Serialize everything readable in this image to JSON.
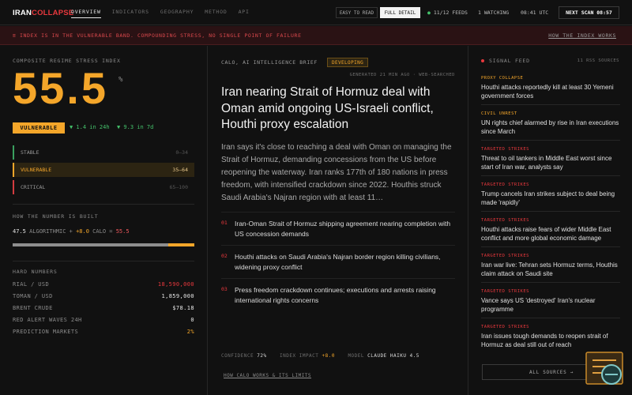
{
  "brand": {
    "part1": "IRAN",
    "part2": "COLLAPSE"
  },
  "nav": [
    {
      "label": "OVERVIEW",
      "active": true
    },
    {
      "label": "INDICATORS",
      "active": false
    },
    {
      "label": "GEOGRAPHY",
      "active": false
    },
    {
      "label": "METHOD",
      "active": false
    },
    {
      "label": "API",
      "active": false
    }
  ],
  "view_toggle": {
    "easy": "EASY TO READ",
    "full": "FULL DETAIL",
    "selected": "full"
  },
  "status": {
    "feeds": "11/12 FEEDS",
    "watching": "1 WATCHING",
    "time": "08:41 UTC",
    "next_scan": "NEXT SCAN 08:57"
  },
  "alert": {
    "message": "≡ INDEX IS IN THE VULNERABLE BAND. COMPOUNDING STRESS, NO SINGLE POINT OF FAILURE",
    "link": "HOW THE INDEX WORKS"
  },
  "index": {
    "label": "COMPOSITE REGIME STRESS INDEX",
    "value": "55.5",
    "unit": "%",
    "band": "VULNERABLE",
    "delta_24h": "▼ 1.4 in 24h",
    "delta_7d": "▼ 9.3 in 7d",
    "bands": [
      {
        "name": "STABLE",
        "range": "0–34"
      },
      {
        "name": "VULNERABLE",
        "range": "35–64"
      },
      {
        "name": "CRITICAL",
        "range": "65–100"
      }
    ]
  },
  "calc": {
    "label": "HOW THE NUMBER IS BUILT",
    "algorithmic": "47.5",
    "algorithmic_label": "ALGORITHMIC",
    "plus": "+",
    "calo": "+8.0",
    "calo_label": "CALO",
    "eq": "=",
    "total": "55.5",
    "algorithmic_share": 0.856,
    "calo_share": 0.144
  },
  "hard_numbers": {
    "label": "HARD NUMBERS",
    "rows": [
      {
        "name": "RIAL / USD",
        "value": "18,590,000",
        "tone": "red"
      },
      {
        "name": "TOMAN / USD",
        "value": "1,859,000",
        "tone": "white"
      },
      {
        "name": "BRENT CRUDE",
        "value": "$78.18",
        "tone": "white"
      },
      {
        "name": "RED ALERT WAVES 24H",
        "value": "0",
        "tone": "white"
      },
      {
        "name": "PREDICTION MARKETS",
        "value": "2%",
        "tone": "amber"
      }
    ]
  },
  "brief": {
    "source": "CALO, AI INTELLIGENCE BRIEF",
    "badge": "DEVELOPING",
    "generated": "GENERATED 21 MIN AGO · WEB-SEARCHED",
    "headline": "Iran nearing Strait of Hormuz deal with Oman amid ongoing US-Israeli conflict, Houthi proxy escalation",
    "summary": "Iran says it's close to reaching a deal with Oman on managing the Strait of Hormuz, demanding concessions from the US before reopening the waterway. Iran ranks 177th of 180 nations in press freedom, with intensified crackdown since 2022. Houthis struck Saudi Arabia's Najran region with at least 11…",
    "bullets": [
      {
        "num": "01",
        "text": "Iran-Oman Strait of Hormuz shipping agreement nearing completion with US concession demands"
      },
      {
        "num": "02",
        "text": "Houthi attacks on Saudi Arabia's Najran border region killing civilians, widening proxy conflict"
      },
      {
        "num": "03",
        "text": "Press freedom crackdown continues; executions and arrests raising international rights concerns"
      }
    ],
    "metrics": {
      "confidence_label": "CONFIDENCE",
      "confidence": "72%",
      "impact_label": "INDEX IMPACT",
      "impact": "+8.0",
      "model_label": "MODEL",
      "model": "CLAUDE HAIKU 4.5"
    },
    "how_link": "HOW CALO WORKS & ITS LIMITS"
  },
  "signal_feed": {
    "title": "SIGNAL FEED",
    "count": "11 RSS SOURCES",
    "items": [
      {
        "category": "PROXY COLLAPSE",
        "tone": "amber",
        "text": "Houthi attacks reportedly kill at least 30 Yemeni government forces"
      },
      {
        "category": "CIVIL UNREST",
        "tone": "amber",
        "text": "UN rights chief alarmed by rise in Iran executions since March"
      },
      {
        "category": "TARGETED STRIKES",
        "tone": "red",
        "text": "Threat to oil tankers in Middle East worst since start of Iran war, analysts say"
      },
      {
        "category": "TARGETED STRIKES",
        "tone": "red",
        "text": "Trump cancels Iran strikes subject to deal being made 'rapidly'"
      },
      {
        "category": "TARGETED STRIKES",
        "tone": "red",
        "text": "Houthi attacks raise fears of wider Middle East conflict and more global economic damage"
      },
      {
        "category": "TARGETED STRIKES",
        "tone": "red",
        "text": "Iran war live: Tehran sets Hormuz terms, Houthis claim attack on Saudi site"
      },
      {
        "category": "TARGETED STRIKES",
        "tone": "red",
        "text": "Vance says US 'destroyed' Iran's nuclear programme"
      },
      {
        "category": "TARGETED STRIKES",
        "tone": "red",
        "text": "Iran issues tough demands to reopen strait of Hormuz as deal still out of reach"
      }
    ],
    "all_sources": "ALL SOURCES →"
  }
}
